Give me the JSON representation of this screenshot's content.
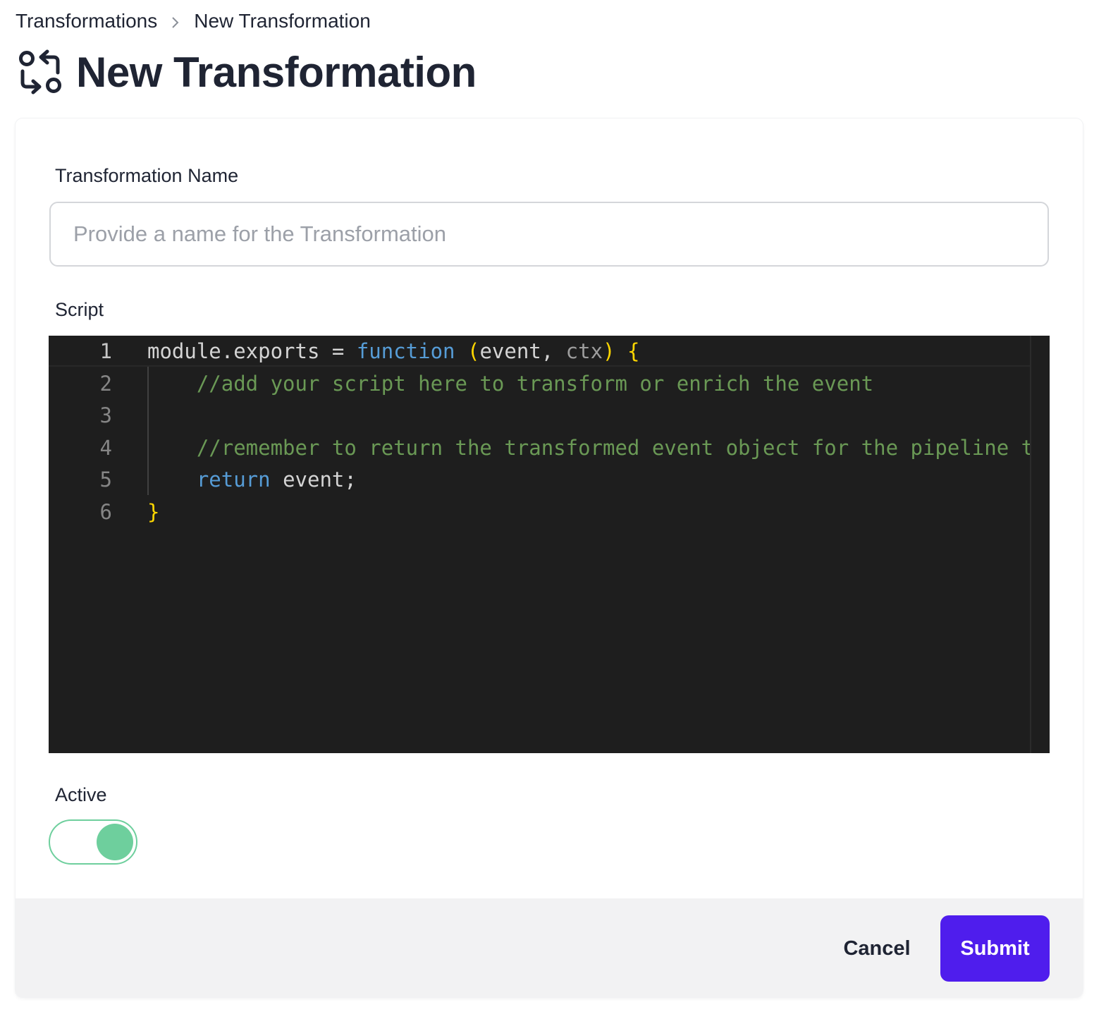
{
  "breadcrumb": {
    "items": [
      "Transformations",
      "New Transformation"
    ]
  },
  "page": {
    "title": "New Transformation",
    "icon": "transformation-swap-icon"
  },
  "form": {
    "name_label": "Transformation Name",
    "name_value": "",
    "name_placeholder": "Provide a name for the Transformation",
    "script_label": "Script",
    "active_label": "Active",
    "active_on": true,
    "cancel_label": "Cancel",
    "submit_label": "Submit"
  },
  "editor": {
    "lines": [
      {
        "number": "1",
        "tokens": [
          {
            "t": "module.exports = ",
            "c": "txt"
          },
          {
            "t": "function",
            "c": "kw"
          },
          {
            "t": " ",
            "c": "txt"
          },
          {
            "t": "(",
            "c": "br"
          },
          {
            "t": "event, ",
            "c": "txt"
          },
          {
            "t": "ctx",
            "c": "dim"
          },
          {
            "t": ")",
            "c": "br"
          },
          {
            "t": " ",
            "c": "txt"
          },
          {
            "t": "{",
            "c": "br"
          }
        ]
      },
      {
        "number": "2",
        "tokens": [
          {
            "t": "    //add your script here to transform or enrich the event",
            "c": "cm"
          }
        ]
      },
      {
        "number": "3",
        "tokens": []
      },
      {
        "number": "4",
        "tokens": [
          {
            "t": "    //remember to return the transformed event object for the pipeline to continue",
            "c": "cm"
          }
        ]
      },
      {
        "number": "5",
        "tokens": [
          {
            "t": "    ",
            "c": "txt"
          },
          {
            "t": "return",
            "c": "kw"
          },
          {
            "t": " event;",
            "c": "txt"
          }
        ]
      },
      {
        "number": "6",
        "tokens": [
          {
            "t": "}",
            "c": "br"
          }
        ]
      }
    ]
  },
  "colors": {
    "accent": "#4f1ded",
    "toggle_on": "#6ecf9d",
    "editor_bg": "#1e1e1e",
    "footer_bg": "#f2f2f3"
  }
}
